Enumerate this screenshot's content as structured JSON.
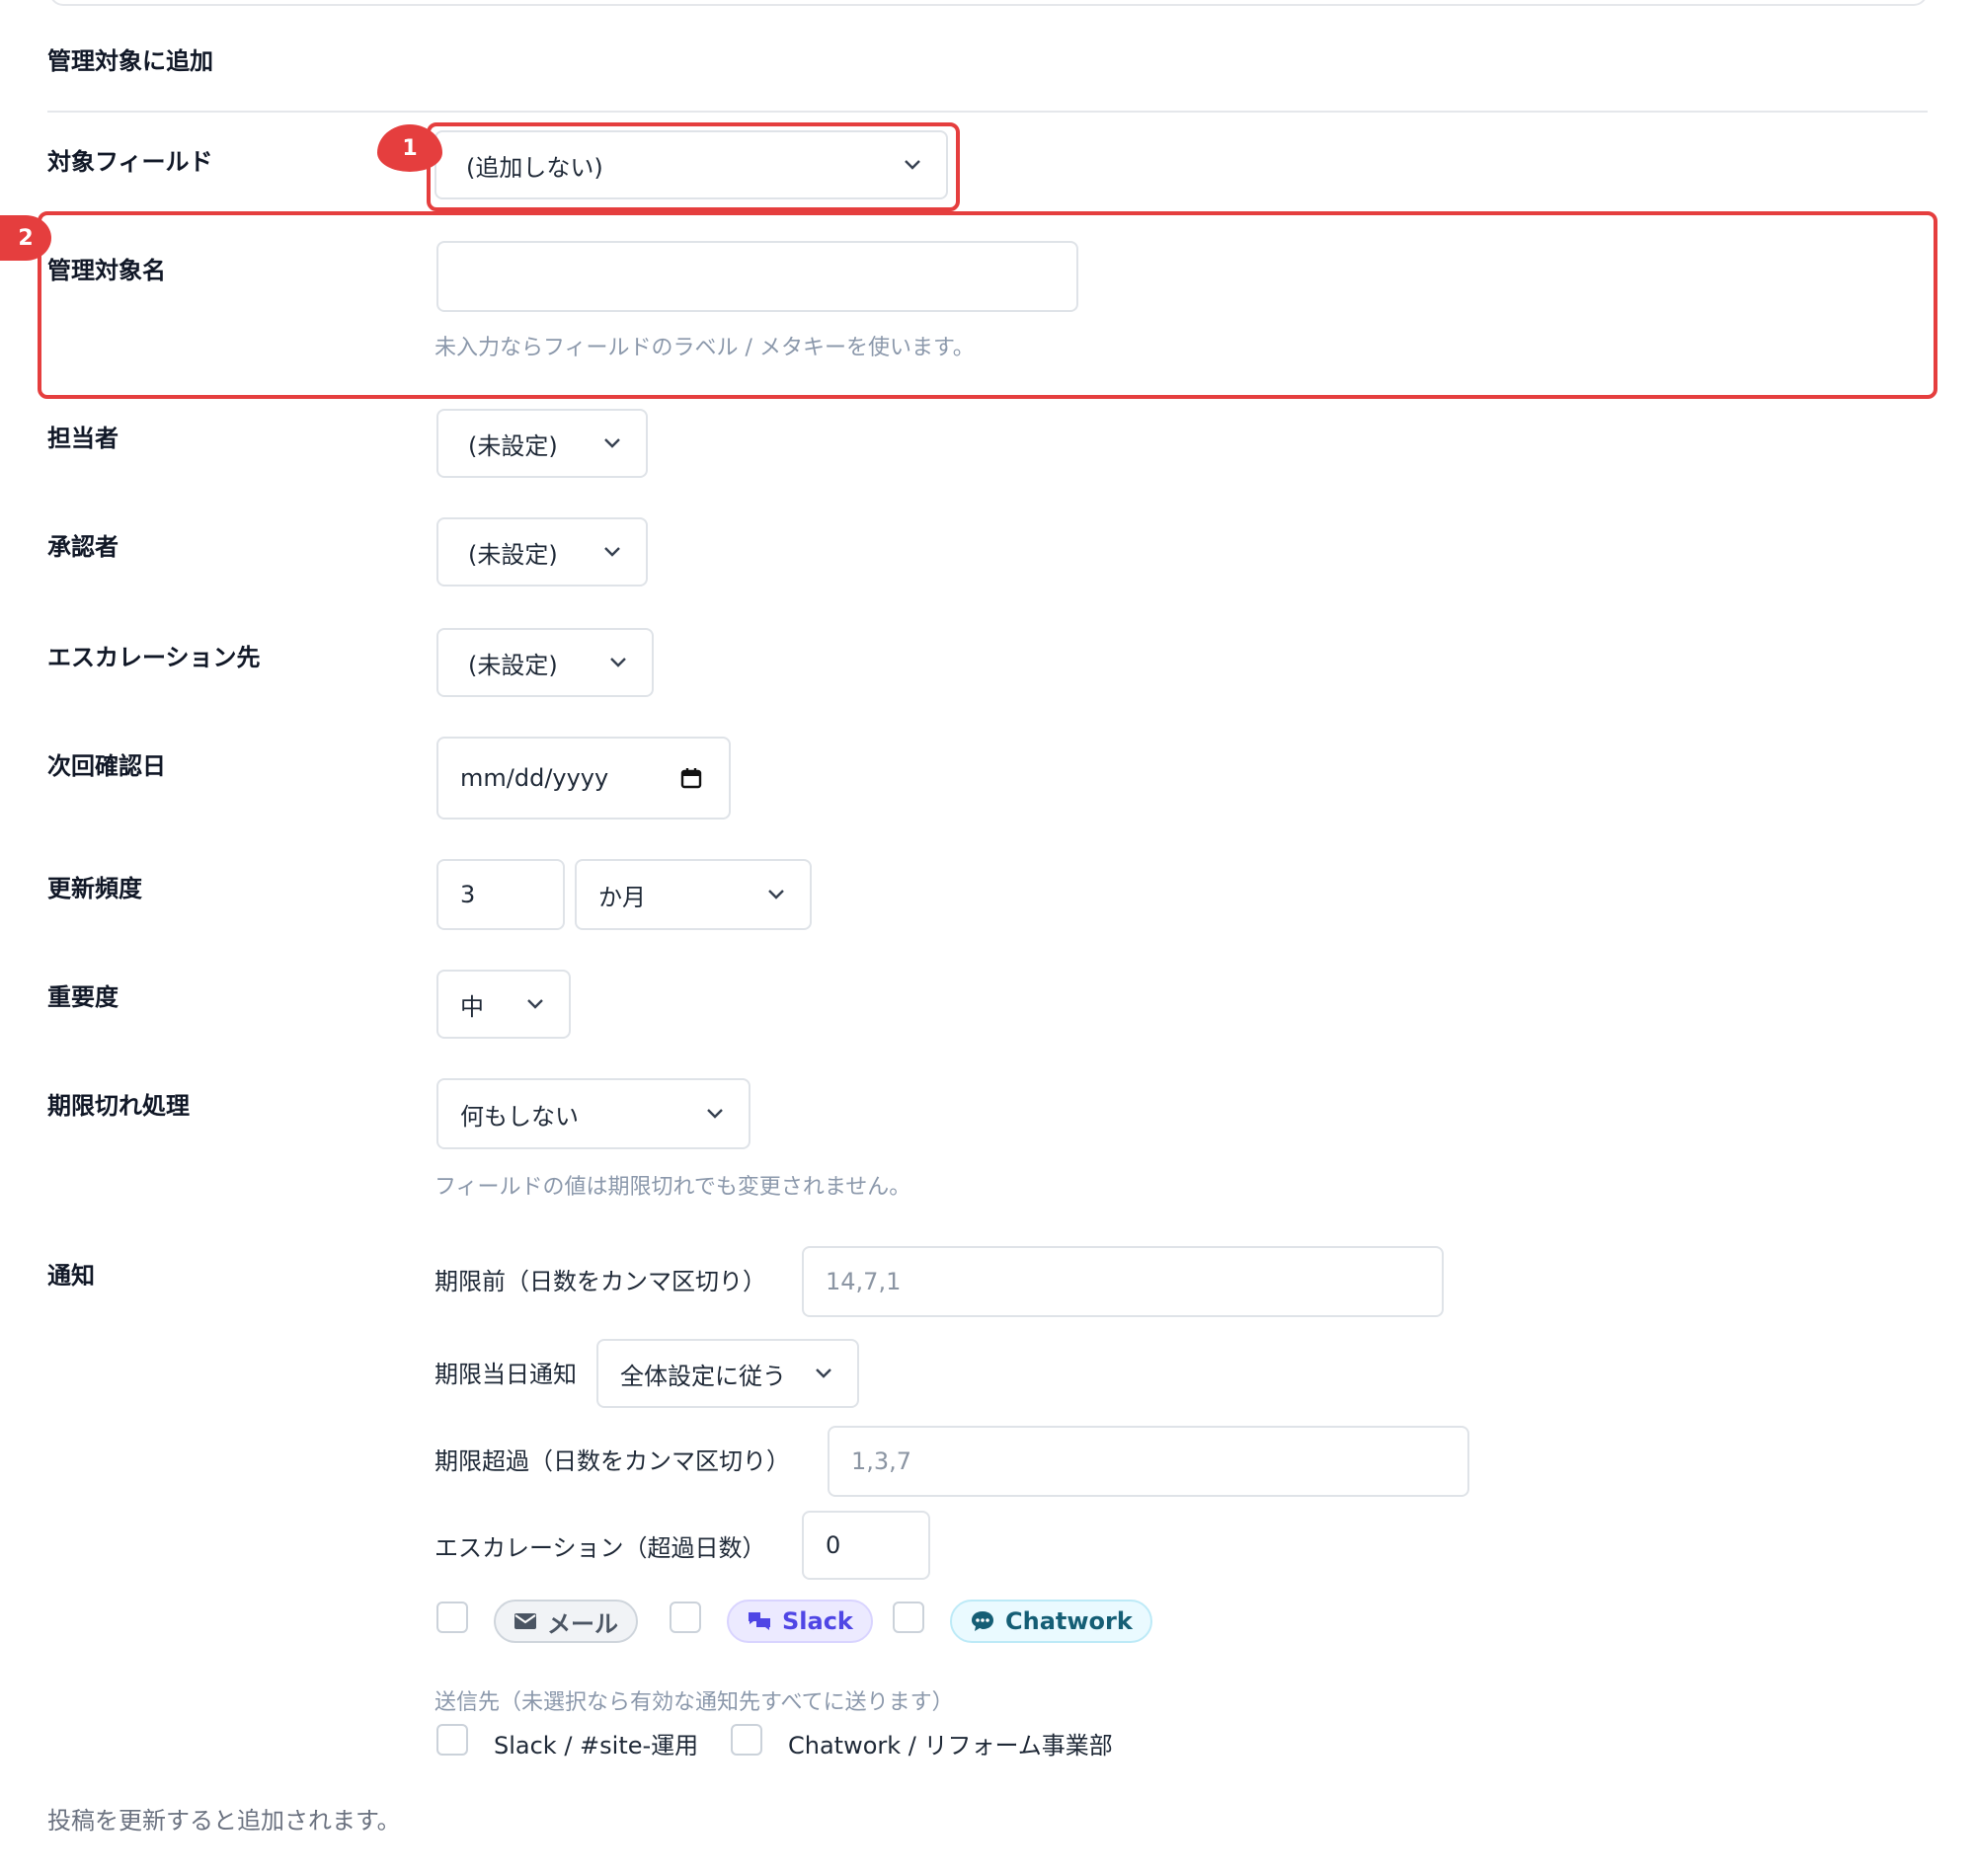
{
  "section_title": "管理対象に追加",
  "fields": {
    "target_field": {
      "label": "対象フィールド",
      "value": "(追加しない)"
    },
    "managed_name": {
      "label": "管理対象名",
      "value": "",
      "help": "未入力ならフィールドのラベル / メタキーを使います。"
    },
    "assignee": {
      "label": "担当者",
      "value": "(未設定)"
    },
    "approver": {
      "label": "承認者",
      "value": "(未設定)"
    },
    "escalation_to": {
      "label": "エスカレーション先",
      "value": "(未設定)"
    },
    "next_check": {
      "label": "次回確認日",
      "placeholder": "mm/dd/yyyy"
    },
    "frequency": {
      "label": "更新頻度",
      "number": "3",
      "unit": "か月"
    },
    "importance": {
      "label": "重要度",
      "value": "中"
    },
    "expiry_action": {
      "label": "期限切れ処理",
      "value": "何もしない",
      "help": "フィールドの値は期限切れでも変更されません。"
    }
  },
  "notify": {
    "label": "通知",
    "before": {
      "label": "期限前（日数をカンマ区切り）",
      "placeholder": "14,7,1"
    },
    "day_of": {
      "label": "期限当日通知",
      "value": "全体設定に従う"
    },
    "overdue": {
      "label": "期限超過（日数をカンマ区切り）",
      "placeholder": "1,3,7"
    },
    "escalation": {
      "label": "エスカレーション（超過日数）",
      "value": "0"
    },
    "channels": {
      "mail": "メール",
      "slack": "Slack",
      "chatwork": "Chatwork"
    },
    "recipients_help": "送信先（未選択なら有効な通知先すべてに送ります）",
    "recipients": [
      "Slack / #site-運用",
      "Chatwork / リフォーム事業部"
    ]
  },
  "footer_note": "投稿を更新すると追加されます。",
  "annotations": {
    "one": "1",
    "two": "2"
  },
  "colors": {
    "highlight": "#e53e3e",
    "slack": "#4f46e5",
    "chatwork": "#155e75",
    "muted": "#8b98ab"
  }
}
